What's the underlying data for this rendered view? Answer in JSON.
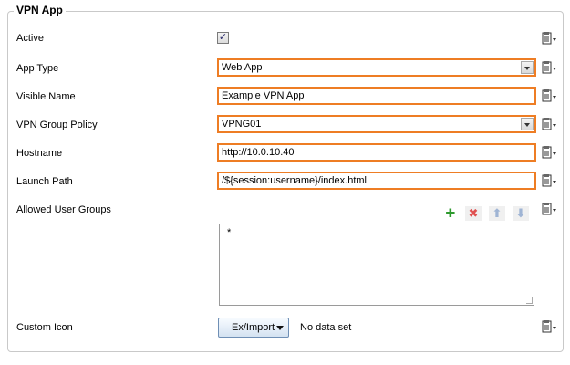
{
  "panel": {
    "title": "VPN App"
  },
  "fields": [
    {
      "label": "Active",
      "type": "checkbox",
      "checked": true
    },
    {
      "label": "App Type",
      "type": "select",
      "value": "Web App"
    },
    {
      "label": "Visible Name",
      "type": "text",
      "value": "Example VPN App"
    },
    {
      "label": "VPN Group Policy",
      "type": "select",
      "value": "VPNG01"
    },
    {
      "label": "Hostname",
      "type": "text",
      "value": "http://10.0.10.40"
    },
    {
      "label": "Launch Path",
      "type": "text",
      "value": "/${session:username}/index.html"
    }
  ],
  "allowed_groups": {
    "label": "Allowed User Groups",
    "items": [
      "*"
    ],
    "toolbar": [
      "add-icon",
      "delete-icon",
      "move-up-icon",
      "move-down-icon"
    ]
  },
  "custom_icon": {
    "label": "Custom Icon",
    "button_label": "Ex/Import",
    "status": "No data set"
  },
  "colors": {
    "accent_border": "#ee7d24",
    "panel_border": "#c9c9c9"
  }
}
